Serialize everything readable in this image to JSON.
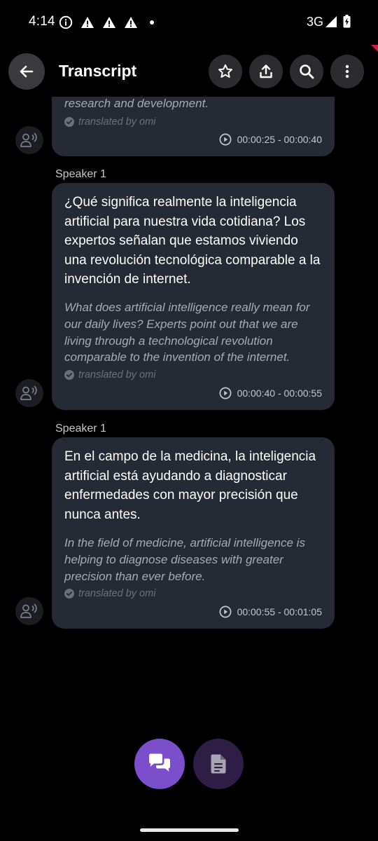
{
  "status_bar": {
    "time": "4:14",
    "network": "3G"
  },
  "app_bar": {
    "title": "Transcript",
    "icons": [
      "back-arrow-icon",
      "star-icon",
      "share-icon",
      "search-icon",
      "more-vert-icon"
    ]
  },
  "segments": [
    {
      "speaker": "",
      "original": "",
      "translation": "research and development.",
      "translated_by": "translated by omi",
      "time_range": "00:00:25 - 00:00:40"
    },
    {
      "speaker": "Speaker 1",
      "original": "¿Qué significa realmente la inteligencia artificial para nuestra vida cotidiana? Los expertos señalan que estamos viviendo una revolución tecnológica comparable a la invención de internet.",
      "translation": "What does artificial intelligence really mean for our daily lives? Experts point out that we are living through a technological revolution comparable to the invention of the internet.",
      "translated_by": "translated by omi",
      "time_range": "00:00:40 - 00:00:55"
    },
    {
      "speaker": "Speaker 1",
      "original": "En el campo de la medicina, la inteligencia artificial está ayudando a diagnosticar enfermedades con mayor precisión que nunca antes.",
      "translation": "In the field of medicine, artificial intelligence is helping to diagnose diseases with greater precision than ever before.",
      "translated_by": "translated by omi",
      "time_range": "00:00:55 - 00:01:05"
    }
  ],
  "bottom_actions": {
    "icons": [
      "chat-bubbles-icon",
      "document-icon"
    ]
  },
  "colors": {
    "background": "#000000",
    "bubble": "#252a35",
    "accent_purple": "#7b4fcc",
    "accent_purple_dark": "#2e1d45"
  }
}
